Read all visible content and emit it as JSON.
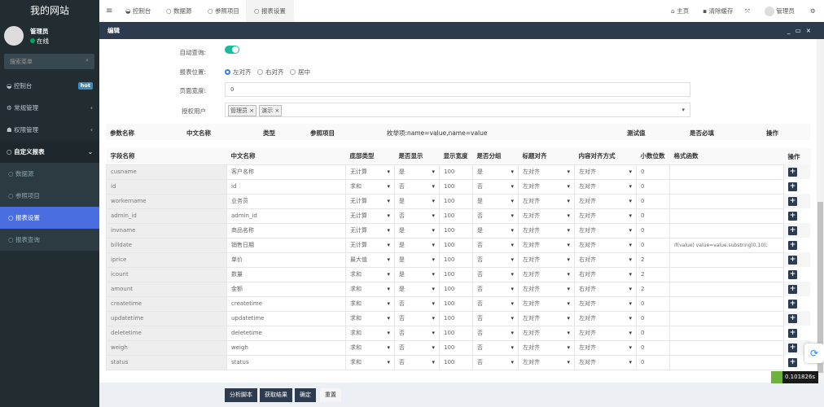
{
  "sidebar": {
    "logo": "我的网站",
    "user": "管理员",
    "status": "在线",
    "search_placeholder": "搜索菜单",
    "items": [
      {
        "label": "控制台",
        "badge": "hot"
      },
      {
        "label": "常规管理"
      },
      {
        "label": "权限管理"
      },
      {
        "label": "自定义报表"
      },
      {
        "label": "数据源"
      },
      {
        "label": "参照项目"
      },
      {
        "label": "报表设置"
      },
      {
        "label": "报表查询"
      }
    ]
  },
  "topbar": {
    "tabs": [
      "控制台",
      "数据源",
      "参照项目",
      "报表设置"
    ],
    "home": "主页",
    "clear_cache": "清除缓存",
    "user": "管理员"
  },
  "modal": {
    "title": "编辑"
  },
  "form": {
    "auto_query_label": "自动查询:",
    "auto_query": true,
    "position_label": "报表位置:",
    "positions": [
      "左对齐",
      "右对齐",
      "居中"
    ],
    "position_selected": "左对齐",
    "width_label": "页面宽度:",
    "width_value": "0",
    "users_label": "授权用户",
    "users": [
      "管理员",
      "演示"
    ]
  },
  "params_header": [
    "参数名称",
    "中文名称",
    "类型",
    "参照项目",
    "枚举项:name=value,name=value",
    "测试值",
    "是否必填",
    "操作"
  ],
  "fields_header": [
    "字段名称",
    "中文名称",
    "底部类型",
    "是否显示",
    "显示宽度",
    "是否分组",
    "标题对齐",
    "内容对齐方式",
    "小数位数",
    "格式函数",
    "操作"
  ],
  "rows": [
    [
      "cusname",
      "客户名称",
      "无计算",
      "是",
      "100",
      "是",
      "左对齐",
      "左对齐",
      "0",
      ""
    ],
    [
      "id",
      "id",
      "求和",
      "否",
      "100",
      "否",
      "左对齐",
      "左对齐",
      "0",
      ""
    ],
    [
      "workername",
      "业务员",
      "无计算",
      "是",
      "100",
      "是",
      "左对齐",
      "左对齐",
      "0",
      ""
    ],
    [
      "admin_id",
      "admin_id",
      "无计算",
      "否",
      "100",
      "否",
      "左对齐",
      "左对齐",
      "0",
      ""
    ],
    [
      "invname",
      "商品名称",
      "无计算",
      "是",
      "100",
      "是",
      "左对齐",
      "左对齐",
      "0",
      ""
    ],
    [
      "billdate",
      "销售日期",
      "无计算",
      "是",
      "100",
      "否",
      "左对齐",
      "左对齐",
      "0",
      "if(value) value=value.substring(0,10);"
    ],
    [
      "iprice",
      "单价",
      "最大值",
      "是",
      "100",
      "否",
      "左对齐",
      "右对齐",
      "2",
      ""
    ],
    [
      "icount",
      "数量",
      "求和",
      "是",
      "100",
      "否",
      "左对齐",
      "右对齐",
      "2",
      ""
    ],
    [
      "amount",
      "金额",
      "求和",
      "是",
      "100",
      "否",
      "左对齐",
      "右对齐",
      "2",
      ""
    ],
    [
      "createtime",
      "createtime",
      "求和",
      "否",
      "100",
      "否",
      "左对齐",
      "左对齐",
      "0",
      ""
    ],
    [
      "updatetime",
      "updatetime",
      "求和",
      "否",
      "100",
      "否",
      "左对齐",
      "左对齐",
      "0",
      ""
    ],
    [
      "deletetime",
      "deletetime",
      "求和",
      "否",
      "100",
      "否",
      "左对齐",
      "左对齐",
      "0",
      ""
    ],
    [
      "weigh",
      "weigh",
      "求和",
      "否",
      "100",
      "否",
      "左对齐",
      "左对齐",
      "0",
      ""
    ],
    [
      "status",
      "status",
      "求和",
      "否",
      "100",
      "否",
      "左对齐",
      "左对齐",
      "0",
      ""
    ]
  ],
  "buttons": {
    "analyze": "分析脚本",
    "fetch": "获取结果",
    "ok": "确定",
    "reset": "重置"
  },
  "timer": "0.101826s",
  "colors": {
    "sidebar": "#222d32",
    "header": "#2c3b4d",
    "active": "#4a6ee0",
    "toggle": "#18bc9c"
  }
}
